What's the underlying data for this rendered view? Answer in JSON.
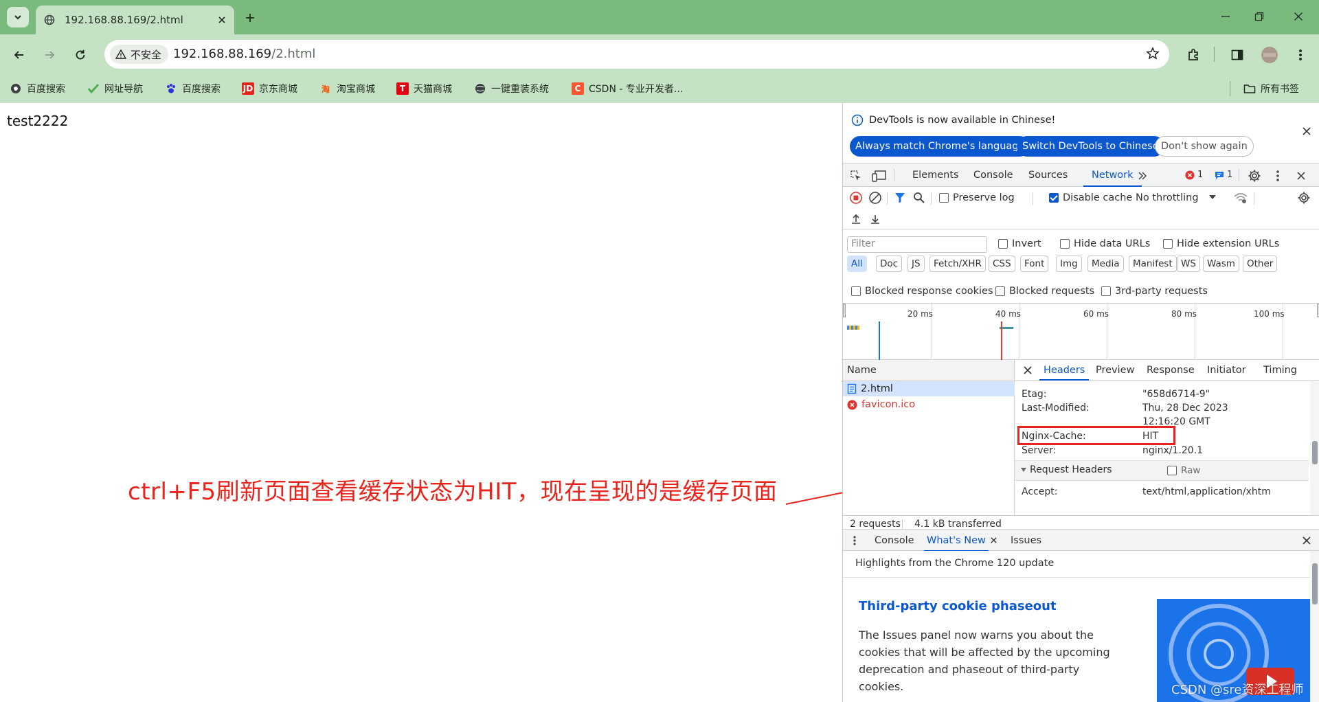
{
  "browser": {
    "tab_title": "192.168.88.169/2.html",
    "security_label": "不安全",
    "url_host": "192.168.88.169",
    "url_path": "/2.html"
  },
  "bookmarks": [
    {
      "label": "百度搜索",
      "icon": "baidu-icon",
      "color": "#2932e1"
    },
    {
      "label": "网址导航",
      "icon": "hao-icon",
      "color": "#4caf50"
    },
    {
      "label": "百度搜索",
      "icon": "baidu-paw-icon",
      "color": "#2932e1"
    },
    {
      "label": "京东商城",
      "icon": "jd-icon",
      "color": "#e1251b"
    },
    {
      "label": "淘宝商城",
      "icon": "taobao-icon",
      "color": "#ff5000"
    },
    {
      "label": "天猫商城",
      "icon": "tmall-icon",
      "color": "#e60012"
    },
    {
      "label": "一键重装系统",
      "icon": "globe-icon",
      "color": "#3c4043"
    },
    {
      "label": "CSDN - 专业开发者...",
      "icon": "csdn-icon",
      "color": "#fc5531"
    }
  ],
  "bookmarks_folder": "所有书签",
  "page": {
    "text": "test2222",
    "annotation": "ctrl+F5刷新页面查看缓存状态为HIT，现在呈现的是缓存页面"
  },
  "devtools": {
    "info_message": "DevTools is now available in Chinese!",
    "btn_match": "Always match Chrome's language",
    "btn_switch": "Switch DevTools to Chinese",
    "btn_dont_show": "Don't show again",
    "tabs": [
      "Elements",
      "Console",
      "Sources",
      "Network"
    ],
    "active_tab": "Network",
    "error_count": "1",
    "message_count": "1",
    "preserve_log": "Preserve log",
    "disable_cache": "Disable cache",
    "throttling": "No throttling",
    "filter_placeholder": "Filter",
    "invert": "Invert",
    "hide_data_urls": "Hide data URLs",
    "hide_extension_urls": "Hide extension URLs",
    "type_filters": [
      "All",
      "Doc",
      "JS",
      "Fetch/XHR",
      "CSS",
      "Font",
      "Img",
      "Media",
      "Manifest",
      "WS",
      "Wasm",
      "Other"
    ],
    "blocked_response_cookies": "Blocked response cookies",
    "blocked_requests": "Blocked requests",
    "third_party_requests": "3rd-party requests",
    "overview_labels": [
      "20 ms",
      "40 ms",
      "60 ms",
      "80 ms",
      "100 ms"
    ],
    "name_header": "Name",
    "requests": [
      {
        "name": "2.html",
        "status": "ok"
      },
      {
        "name": "favicon.ico",
        "status": "error"
      }
    ],
    "detail_tabs": [
      "Headers",
      "Preview",
      "Response",
      "Initiator",
      "Timing"
    ],
    "response_headers": [
      {
        "name": "Etag:",
        "value": "\"658d6714-9\""
      },
      {
        "name": "Last-Modified:",
        "value": "Thu, 28 Dec 2023"
      },
      {
        "name": "",
        "value": "12:16:20 GMT"
      },
      {
        "name": "Nginx-Cache:",
        "value": "HIT"
      },
      {
        "name": "Server:",
        "value": "nginx/1.20.1"
      }
    ],
    "request_headers_title": "Request Headers",
    "raw_label": "Raw",
    "request_headers": [
      {
        "name": "Accept:",
        "value": "text/html,application/xhtm"
      }
    ],
    "status_requests": "2 requests",
    "status_transferred": "4.1 kB transferred",
    "drawer_tabs": [
      "Console",
      "What's New",
      "Issues"
    ],
    "drawer_active": "What's New",
    "highlights": "Highlights from the Chrome 120 update",
    "feature_title": "Third-party cookie phaseout",
    "feature_body": "The Issues panel now warns you about the cookies that will be affected by the upcoming deprecation and phaseout of third-party cookies."
  },
  "watermark": "CSDN @sre资深工程师",
  "colors": {
    "accent": "#0b57d0",
    "annotation_red": "#e8241c",
    "chrome_green": "#7aba7c",
    "toolbar_green": "#c5e2c4"
  }
}
